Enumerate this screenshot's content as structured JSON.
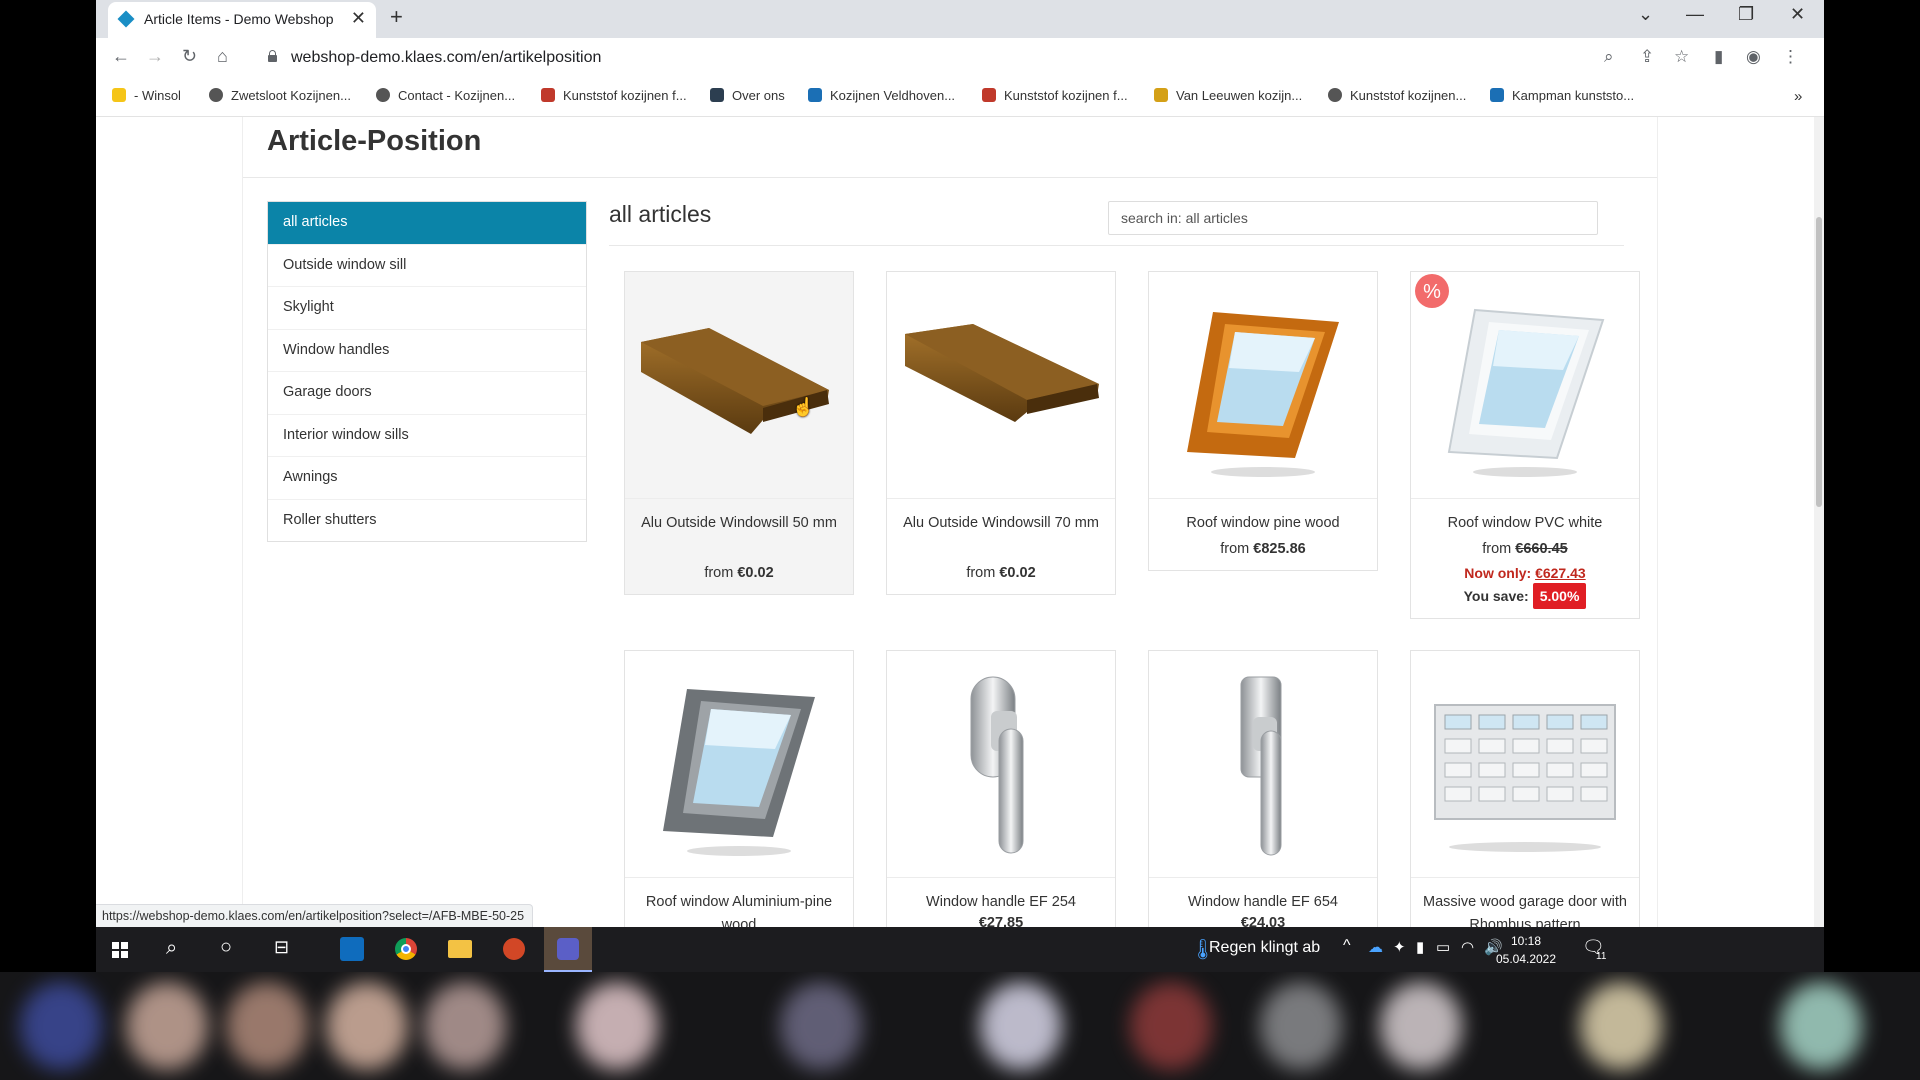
{
  "browser": {
    "tab_title": "Article Items - Demo Webshop",
    "url": "webshop-demo.klaes.com/en/artikelposition",
    "bookmarks": [
      {
        "label": "- Winsol",
        "color": "#f5c518"
      },
      {
        "label": "Zwetsloot Kozijnen...",
        "color": "#555555"
      },
      {
        "label": "Contact - Kozijnen...",
        "color": "#555555"
      },
      {
        "label": "Kunststof kozijnen f...",
        "color": "#c0392b"
      },
      {
        "label": "Over ons",
        "color": "#2c3e50"
      },
      {
        "label": "Kozijnen Veldhoven...",
        "color": "#1b6fb5"
      },
      {
        "label": "Kunststof kozijnen f...",
        "color": "#c0392b"
      },
      {
        "label": "Van Leeuwen kozijn...",
        "color": "#d4a017"
      },
      {
        "label": "Kunststof kozijnen...",
        "color": "#555555"
      },
      {
        "label": "Kampman kunststo...",
        "color": "#1b6fb5"
      }
    ],
    "status_url": "https://webshop-demo.klaes.com/en/artikelposition?select=/AFB-MBE-50-25"
  },
  "page": {
    "title": "Article-Position",
    "section_title": "all articles",
    "search_placeholder": "search in: all articles",
    "categories": [
      "all articles",
      "Outside window sill",
      "Skylight",
      "Window handles",
      "Garage doors",
      "Interior window sills",
      "Awnings",
      "Roller shutters"
    ],
    "products": [
      {
        "name": "Alu Outside Windowsill 50 mm",
        "price_prefix": "from",
        "price": "€0.02",
        "icon": "windowsill-image"
      },
      {
        "name": "Alu Outside Windowsill 70 mm",
        "price_prefix": "from",
        "price": "€0.02",
        "icon": "windowsill-image"
      },
      {
        "name": "Roof window pine wood",
        "price_prefix": "from",
        "price": "€825.86",
        "icon": "roof-window-wood-image"
      },
      {
        "name": "Roof window PVC white",
        "price_prefix": "from",
        "price": "€660.45",
        "now_only_label": "Now only:",
        "now_price": "€627.43",
        "save_label": "You save:",
        "save_pct": "5.00%",
        "badge": "%",
        "icon": "roof-window-white-image"
      },
      {
        "name": "Roof window Aluminium-pine wood",
        "price_prefix": "",
        "price": "",
        "icon": "roof-window-alu-image"
      },
      {
        "name": "Window handle EF 254",
        "price_prefix": "",
        "price": "€27.85",
        "icon": "window-handle-image"
      },
      {
        "name": "Window handle EF 654",
        "price_prefix": "",
        "price": "€24.03",
        "icon": "window-handle-image"
      },
      {
        "name": "Massive wood garage door with Rhombus pattern",
        "price_prefix": "",
        "price": "",
        "icon": "garage-door-image"
      }
    ]
  },
  "taskbar": {
    "weather": "Regen klingt ab",
    "time": "10:18",
    "date": "05.04.2022",
    "notification_count": "11"
  }
}
